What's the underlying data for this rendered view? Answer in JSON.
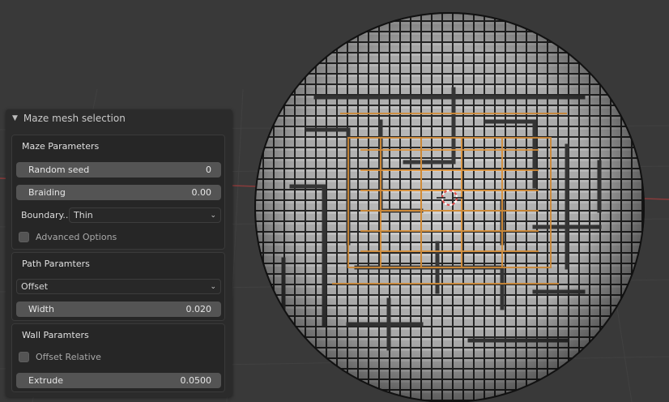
{
  "panel": {
    "title": "Maze mesh selection",
    "maze": {
      "title": "Maze Parameters",
      "random_seed_label": "Random seed",
      "random_seed_value": "0",
      "braiding_label": "Braiding",
      "braiding_value": "0.00",
      "boundary_label": "Boundary..",
      "boundary_value": "Thin",
      "advanced_label": "Advanced Options"
    },
    "path": {
      "title": "Path Paramters",
      "mode_value": "Offset",
      "width_label": "Width",
      "width_value": "0.020"
    },
    "wall": {
      "title": "Wall Paramters",
      "offset_relative_label": "Offset Relative",
      "extrude_label": "Extrude",
      "extrude_value": "0.0500"
    }
  },
  "colors": {
    "viewport_bg": "#393939",
    "grid_red_axis": "#8a3b3b",
    "sphere_face": "#b5b5b5",
    "selection": "#e89a3c"
  },
  "icons": {
    "collapse": "triangle-down-icon",
    "dropdown": "chevron-down-icon",
    "cursor": "3d-cursor-icon"
  }
}
